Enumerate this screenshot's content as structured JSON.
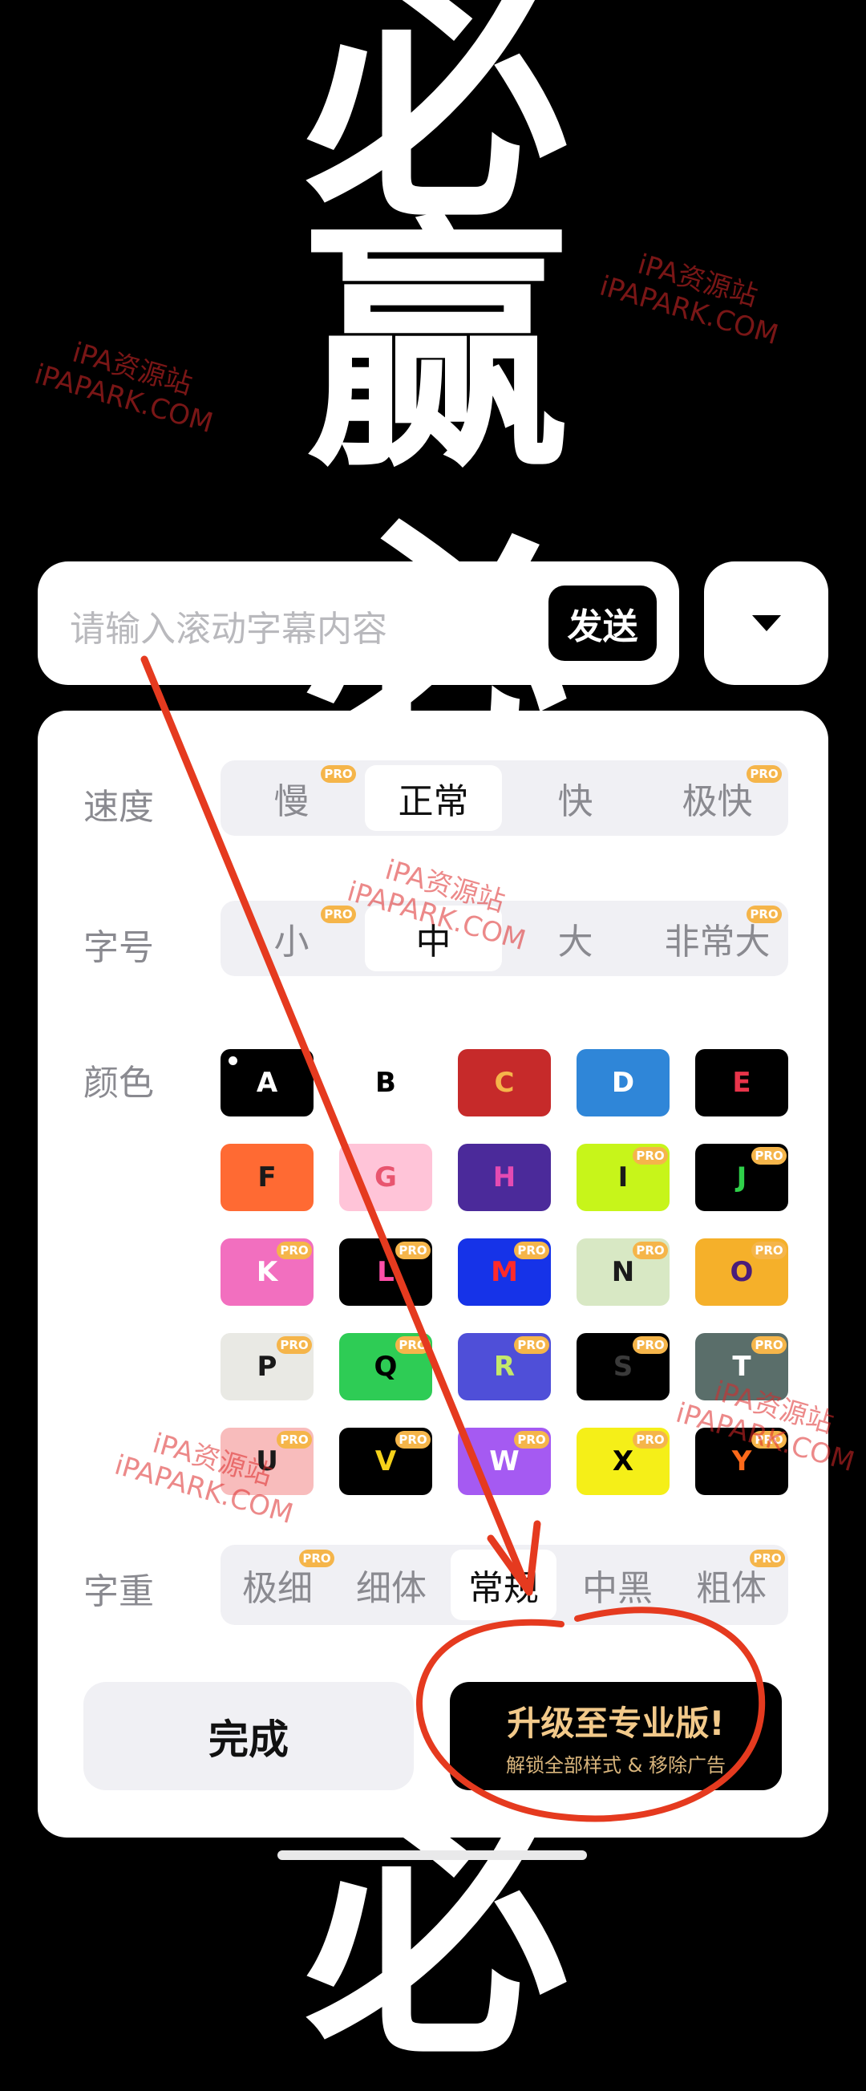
{
  "background_text": [
    "必",
    "赢",
    "必",
    "必"
  ],
  "input": {
    "placeholder": "请输入滚动字幕内容",
    "send_label": "发送"
  },
  "dropdown_icon": "triangle-down-icon",
  "speed": {
    "label": "速度",
    "options": [
      "慢",
      "正常",
      "快",
      "极快"
    ],
    "selected": "正常",
    "pro": [
      true,
      false,
      false,
      true
    ]
  },
  "font_size": {
    "label": "字号",
    "options": [
      "小",
      "中",
      "大",
      "非常大"
    ],
    "selected": "中",
    "pro": [
      true,
      false,
      false,
      true
    ]
  },
  "color": {
    "label": "颜色",
    "swatches": [
      {
        "letter": "A",
        "bg": "#000000",
        "fg": "#ffffff",
        "pro": false,
        "selected": true
      },
      {
        "letter": "B",
        "bg": "#ffffff",
        "fg": "#000000",
        "pro": false
      },
      {
        "letter": "C",
        "bg": "#c62a2a",
        "fg": "#f5b54a",
        "pro": false
      },
      {
        "letter": "D",
        "bg": "#2f86d8",
        "fg": "#ffffff",
        "pro": false
      },
      {
        "letter": "E",
        "bg": "#000000",
        "fg": "#e8344a",
        "pro": false
      },
      {
        "letter": "F",
        "bg": "#ff6a33",
        "fg": "#1a1a1a",
        "pro": false
      },
      {
        "letter": "G",
        "bg": "#ffc4d8",
        "fg": "#e8556f",
        "pro": false
      },
      {
        "letter": "H",
        "bg": "#4b2a9a",
        "fg": "#e44bb2",
        "pro": false
      },
      {
        "letter": "I",
        "bg": "#c7f51a",
        "fg": "#1a1a1a",
        "pro": true
      },
      {
        "letter": "J",
        "bg": "#000000",
        "fg": "#2fd04a",
        "pro": true
      },
      {
        "letter": "K",
        "bg": "#f26fbf",
        "fg": "#ffffff",
        "pro": true
      },
      {
        "letter": "L",
        "bg": "#000000",
        "fg": "#ff4fa8",
        "pro": true
      },
      {
        "letter": "M",
        "bg": "#1633e8",
        "fg": "#ff2a2a",
        "pro": true
      },
      {
        "letter": "N",
        "bg": "#d8e8c4",
        "fg": "#1a1a1a",
        "pro": true
      },
      {
        "letter": "O",
        "bg": "#f5b02a",
        "fg": "#4a1d7a",
        "pro": true
      },
      {
        "letter": "P",
        "bg": "#e9e9e4",
        "fg": "#1a1a1a",
        "pro": true
      },
      {
        "letter": "Q",
        "bg": "#2ecc55",
        "fg": "#000000",
        "pro": true
      },
      {
        "letter": "R",
        "bg": "#4f4fd8",
        "fg": "#c4e86a",
        "pro": true
      },
      {
        "letter": "S",
        "bg": "#000000",
        "fg": "#3a3a3a",
        "pro": true
      },
      {
        "letter": "T",
        "bg": "#5a6e6a",
        "fg": "#ffffff",
        "pro": true
      },
      {
        "letter": "U",
        "bg": "#f8bcbc",
        "fg": "#1a1a1a",
        "pro": true
      },
      {
        "letter": "V",
        "bg": "#000000",
        "fg": "#f5d21a",
        "pro": true
      },
      {
        "letter": "W",
        "bg": "#a55af2",
        "fg": "#ffffff",
        "pro": true
      },
      {
        "letter": "X",
        "bg": "#f5ef18",
        "fg": "#000000",
        "pro": true
      },
      {
        "letter": "Y",
        "bg": "#000000",
        "fg": "#ff6a1a",
        "pro": true
      }
    ]
  },
  "weight": {
    "label": "字重",
    "options": [
      "极细",
      "细体",
      "常规",
      "中黑",
      "粗体"
    ],
    "selected": "常规",
    "pro": [
      true,
      false,
      false,
      false,
      true
    ]
  },
  "pro_badge": "PRO",
  "done_label": "完成",
  "upgrade": {
    "title": "升级至专业版!",
    "subtitle": "解锁全部样式 & 移除广告"
  },
  "watermarks": [
    {
      "line1": "iPA资源站",
      "line2": "iPAPARK.COM"
    },
    {
      "line1": "iPA资源站",
      "line2": "iPAPARK.COM"
    },
    {
      "line1": "iPA资源站",
      "line2": "iPAPARK.COM"
    },
    {
      "line1": "iPA资源站",
      "line2": "iPAPARK.COM"
    },
    {
      "line1": "iPA资源站",
      "line2": "iPAPARK.COM"
    }
  ],
  "accent": {
    "pro_badge": "#f5b54a",
    "annotation": "#e53a1f",
    "upgrade_text": "#f2c98a"
  }
}
